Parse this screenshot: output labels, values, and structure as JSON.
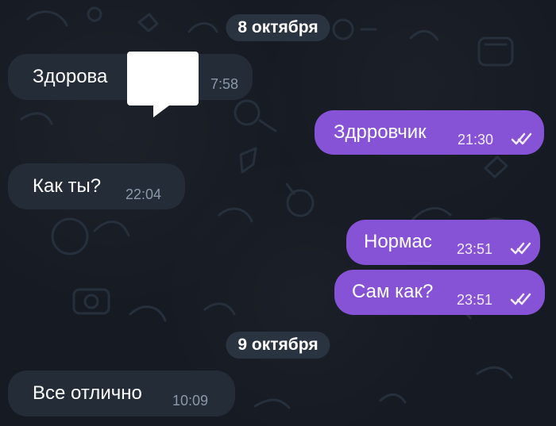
{
  "dates": [
    "8 октября",
    "9 октября"
  ],
  "messages": [
    {
      "direction": "incoming",
      "text": "Здорова",
      "time": "7:58",
      "has_sticker": true
    },
    {
      "direction": "outgoing",
      "text": "Здрровчик",
      "time": "21:30",
      "status": "read"
    },
    {
      "direction": "incoming",
      "text": "Как ты?",
      "time": "22:04"
    },
    {
      "direction": "outgoing",
      "text": "Нормас",
      "time": "23:51",
      "status": "read"
    },
    {
      "direction": "outgoing",
      "text": "Сам как?",
      "time": "23:51",
      "status": "read"
    },
    {
      "direction": "incoming",
      "text": "Все отлично",
      "time": "10:09"
    }
  ],
  "colors": {
    "background": "#161a22",
    "incoming_bubble": "#232c37",
    "outgoing_bubble": "#8753d6",
    "date_chip": "#2a3441",
    "time_incoming": "#8b98a8",
    "time_outgoing": "#f2ecff"
  },
  "icons": [
    "double-check-icon"
  ]
}
